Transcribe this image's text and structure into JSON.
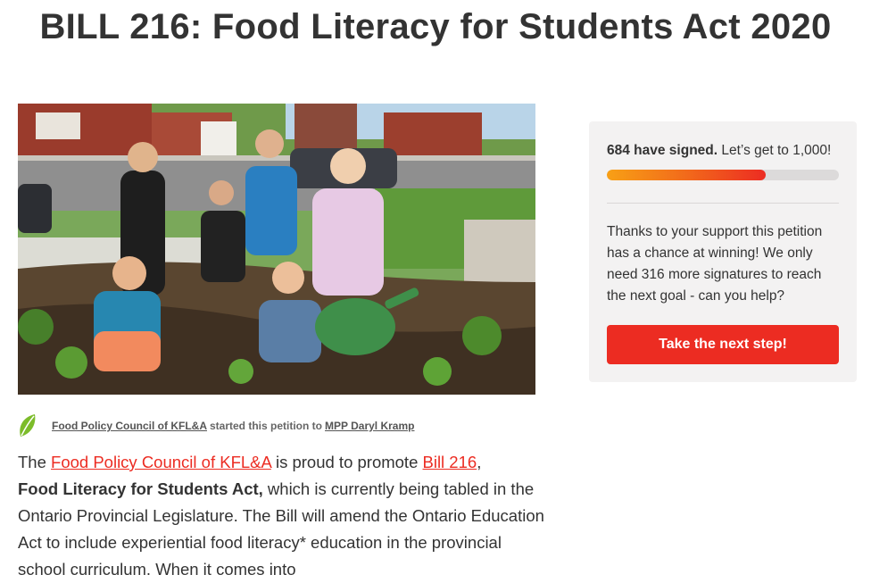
{
  "page": {
    "title": "BILL 216: Food Literacy for Students Act 2020"
  },
  "starter": {
    "organization": "Food Policy Council of KFL&A",
    "middle_text": "started this petition to",
    "recipient": "MPP Daryl Kramp"
  },
  "description": {
    "p1_text1": "The ",
    "p1_link1": "Food Policy Council of KFL&A",
    "p1_text2": " is proud to promote  ",
    "p1_link2": "Bill 216",
    "p1_text3": ",",
    "p1_bold": "Food Literacy for Students Act,",
    "p1_text4": " which is currently being tabled in the Ontario Provincial Legislature.  The Bill will amend the Ontario Education Act to include experiential food literacy* education in the provincial school curriculum. When it comes into"
  },
  "sidebar": {
    "signed_count": "684 have signed.",
    "goal_text": "Let’s get to 1,000!",
    "progress_fraction": 0.684,
    "support_text": "Thanks to your support this petition has a chance at winning! We only need 316 more signatures to reach the next goal - can you help?",
    "cta_label": "Take the next step!"
  },
  "icons": {
    "starter_avatar": "leaf-icon"
  },
  "colors": {
    "accent": "#ec2c22",
    "progress_start": "#f8a015",
    "progress_end": "#ec2c22",
    "leaf": "#7cbc2a",
    "sidebar_bg": "#f3f2f2"
  }
}
